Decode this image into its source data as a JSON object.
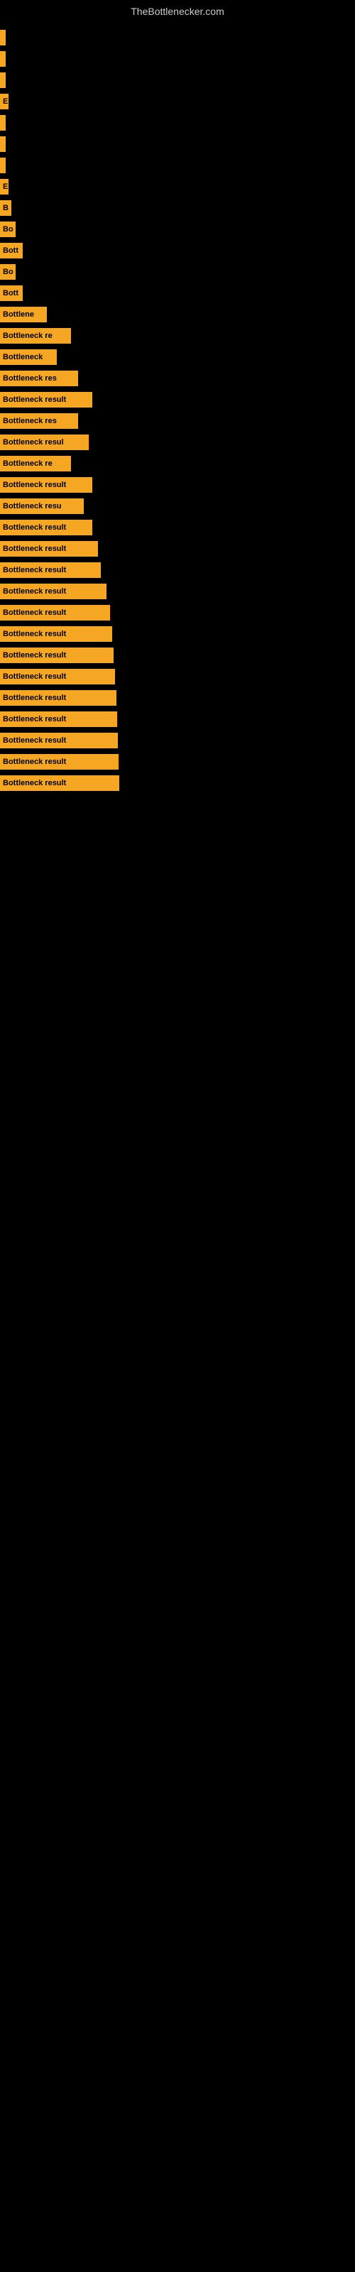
{
  "site_title": "TheBottlenecker.com",
  "bars": [
    {
      "label": "",
      "width": 4
    },
    {
      "label": "",
      "width": 4
    },
    {
      "label": "",
      "width": 4
    },
    {
      "label": "E",
      "width": 12
    },
    {
      "label": "",
      "width": 4
    },
    {
      "label": "",
      "width": 4
    },
    {
      "label": "",
      "width": 4
    },
    {
      "label": "E",
      "width": 12
    },
    {
      "label": "B",
      "width": 16
    },
    {
      "label": "Bo",
      "width": 22
    },
    {
      "label": "Bott",
      "width": 32
    },
    {
      "label": "Bo",
      "width": 22
    },
    {
      "label": "Bott",
      "width": 32
    },
    {
      "label": "Bottlene",
      "width": 66
    },
    {
      "label": "Bottleneck re",
      "width": 100
    },
    {
      "label": "Bottleneck",
      "width": 80
    },
    {
      "label": "Bottleneck res",
      "width": 110
    },
    {
      "label": "Bottleneck result",
      "width": 130
    },
    {
      "label": "Bottleneck res",
      "width": 110
    },
    {
      "label": "Bottleneck resul",
      "width": 125
    },
    {
      "label": "Bottleneck re",
      "width": 100
    },
    {
      "label": "Bottleneck result",
      "width": 130
    },
    {
      "label": "Bottleneck resu",
      "width": 118
    },
    {
      "label": "Bottleneck result",
      "width": 130
    },
    {
      "label": "Bottleneck result",
      "width": 138
    },
    {
      "label": "Bottleneck result",
      "width": 142
    },
    {
      "label": "Bottleneck result",
      "width": 150
    },
    {
      "label": "Bottleneck result",
      "width": 155
    },
    {
      "label": "Bottleneck result",
      "width": 158
    },
    {
      "label": "Bottleneck result",
      "width": 160
    },
    {
      "label": "Bottleneck result",
      "width": 162
    },
    {
      "label": "Bottleneck result",
      "width": 164
    },
    {
      "label": "Bottleneck result",
      "width": 165
    },
    {
      "label": "Bottleneck result",
      "width": 166
    },
    {
      "label": "Bottleneck result",
      "width": 167
    },
    {
      "label": "Bottleneck result",
      "width": 168
    }
  ]
}
